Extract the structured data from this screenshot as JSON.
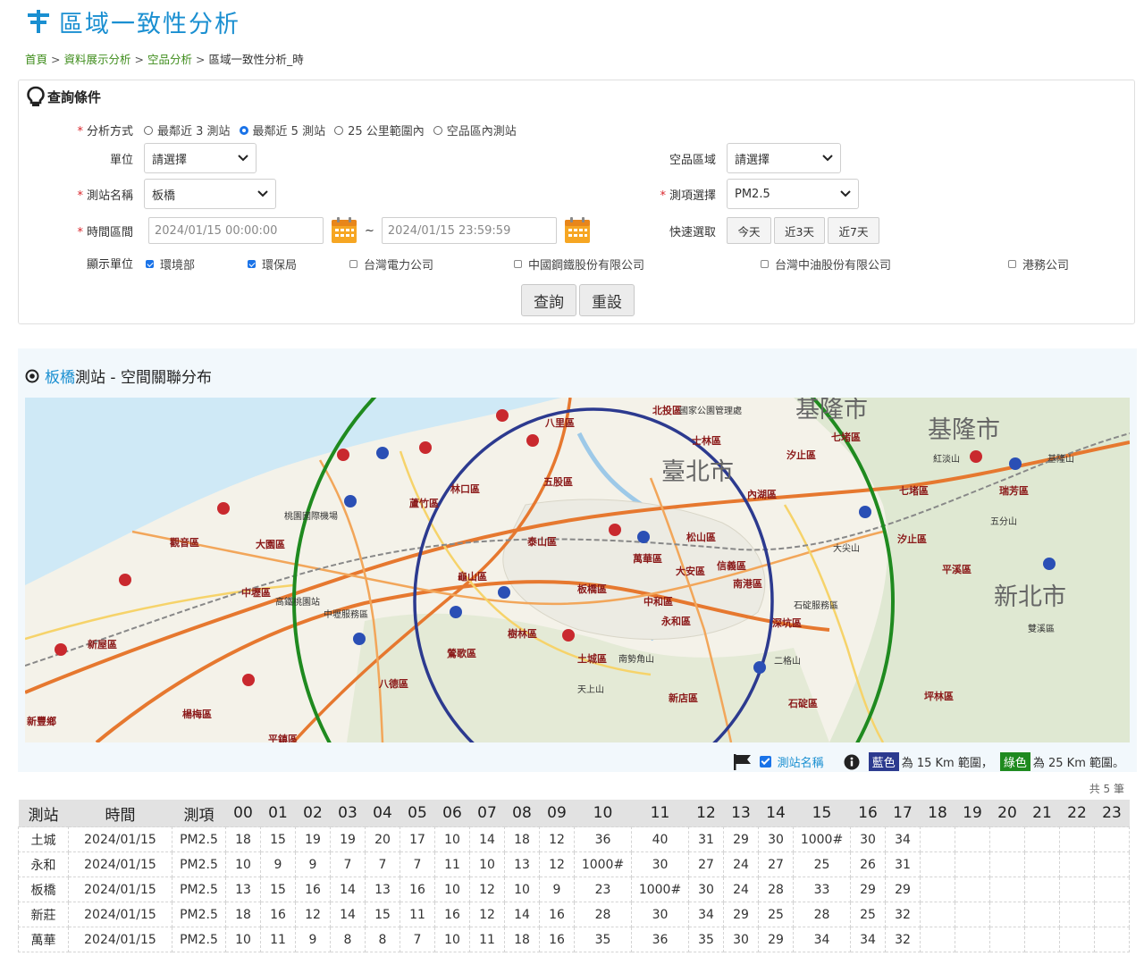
{
  "page": {
    "title": "區域一致性分析",
    "breadcrumb": [
      {
        "label": "首頁",
        "link": true
      },
      {
        "label": "資料展示分析",
        "link": true
      },
      {
        "label": "空品分析",
        "link": true
      },
      {
        "label": "區域一致性分析_時",
        "link": false
      }
    ]
  },
  "query": {
    "panel_title": "查詢條件",
    "method": {
      "label": "分析方式",
      "options": [
        {
          "label": "最鄰近 3 測站",
          "selected": false
        },
        {
          "label": "最鄰近 5 測站",
          "selected": true
        },
        {
          "label": "25 公里範圍內",
          "selected": false
        },
        {
          "label": "空品區內測站",
          "selected": false
        }
      ]
    },
    "unit": {
      "label": "單位",
      "value": "請選擇"
    },
    "air_zone": {
      "label": "空品區域",
      "value": "請選擇"
    },
    "station": {
      "label": "測站名稱",
      "value": "板橋"
    },
    "item": {
      "label": "測項選擇",
      "value": "PM2.5"
    },
    "period": {
      "label": "時間區間",
      "start": "2024/01/15 00:00:00",
      "end": "2024/01/15 23:59:59",
      "tilde": "~"
    },
    "quick": {
      "label": "快速選取",
      "buttons": [
        "今天",
        "近3天",
        "近7天"
      ]
    },
    "display_units": {
      "label": "顯示單位",
      "items": [
        {
          "label": "環境部",
          "checked": true
        },
        {
          "label": "環保局",
          "checked": true
        },
        {
          "label": "台灣電力公司",
          "checked": false
        },
        {
          "label": "中國鋼鐵股份有限公司",
          "checked": false
        },
        {
          "label": "台灣中油股份有限公司",
          "checked": false
        },
        {
          "label": "港務公司",
          "checked": false
        }
      ]
    },
    "submit_label": "查詢",
    "reset_label": "重設"
  },
  "map": {
    "station": "板橋",
    "title_suffix": "測站 - 空間關聯分布",
    "colors": {
      "ring_15km": "#2c3a8f",
      "ring_25km": "#1f8a1f"
    },
    "labels": {
      "cities": [
        "臺北市",
        "新北市",
        "基隆市",
        "基隆市"
      ],
      "districts": [
        "八里區",
        "五股區",
        "林口區",
        "蘆竹區",
        "泰山區",
        "龜山區",
        "板橋區",
        "萬華區",
        "大安區",
        "信義區",
        "南港區",
        "內湖區",
        "松山區",
        "汐止區",
        "樹林區",
        "鶯歌區",
        "土城區",
        "中和區",
        "永和區",
        "新店區",
        "深坑區",
        "石碇區",
        "坪林區",
        "平溪區",
        "瑞芳區",
        "七堵區",
        "七堵區",
        "汐止區",
        "北投區",
        "士林區",
        "大園區",
        "觀音區",
        "中壢區",
        "新屋區",
        "八德區",
        "楊梅區",
        "平鎮區",
        "新豐鄉",
        "桃園國際機場",
        "高鐵桃園站",
        "中壢服務區",
        "南勢角山",
        "天上山",
        "二格山",
        "大尖山",
        "五分山",
        "紅淡山",
        "基隆山",
        "雙溪區",
        "石碇服務區",
        "國家公園管理處"
      ]
    },
    "legend": {
      "station_toggle": "測站名稱",
      "blue_tag": "藍色",
      "blue_text": "為 15 Km 範圍，",
      "green_tag": "綠色",
      "green_text": "為 25 Km 範圍。"
    }
  },
  "table": {
    "count_text": "共 5 筆",
    "headers": [
      "測站",
      "時間",
      "測項",
      "00",
      "01",
      "02",
      "03",
      "04",
      "05",
      "06",
      "07",
      "08",
      "09",
      "10",
      "11",
      "12",
      "13",
      "14",
      "15",
      "16",
      "17",
      "18",
      "19",
      "20",
      "21",
      "22",
      "23"
    ],
    "rows": [
      [
        "土城",
        "2024/01/15",
        "PM2.5",
        "18",
        "15",
        "19",
        "19",
        "20",
        "17",
        "10",
        "14",
        "18",
        "12",
        "36",
        "40",
        "31",
        "29",
        "30",
        "1000#",
        "30",
        "34",
        "",
        "",
        "",
        "",
        "",
        ""
      ],
      [
        "永和",
        "2024/01/15",
        "PM2.5",
        "10",
        "9",
        "9",
        "7",
        "7",
        "7",
        "11",
        "10",
        "13",
        "12",
        "1000#",
        "30",
        "27",
        "24",
        "27",
        "25",
        "26",
        "31",
        "",
        "",
        "",
        "",
        "",
        ""
      ],
      [
        "板橋",
        "2024/01/15",
        "PM2.5",
        "13",
        "15",
        "16",
        "14",
        "13",
        "16",
        "10",
        "12",
        "10",
        "9",
        "23",
        "1000#",
        "30",
        "24",
        "28",
        "33",
        "29",
        "29",
        "",
        "",
        "",
        "",
        "",
        ""
      ],
      [
        "新莊",
        "2024/01/15",
        "PM2.5",
        "18",
        "16",
        "12",
        "14",
        "15",
        "11",
        "16",
        "12",
        "14",
        "16",
        "28",
        "30",
        "34",
        "29",
        "25",
        "28",
        "25",
        "32",
        "",
        "",
        "",
        "",
        "",
        ""
      ],
      [
        "萬華",
        "2024/01/15",
        "PM2.5",
        "10",
        "11",
        "9",
        "8",
        "8",
        "7",
        "10",
        "11",
        "18",
        "16",
        "35",
        "36",
        "35",
        "30",
        "29",
        "34",
        "34",
        "32",
        "",
        "",
        "",
        "",
        "",
        ""
      ]
    ]
  }
}
